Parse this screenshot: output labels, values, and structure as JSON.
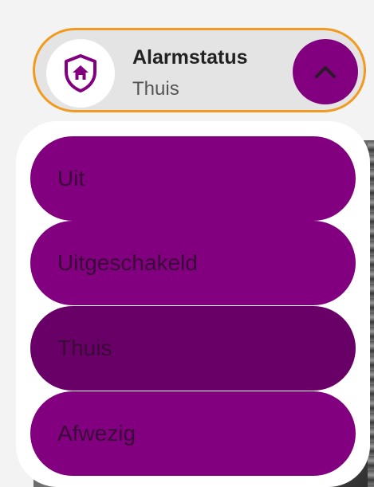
{
  "status": {
    "title": "Alarmstatus",
    "value": "Thuis",
    "icon": "shield-home-icon",
    "toggle_icon": "chevron-up-icon"
  },
  "menu": {
    "items": [
      {
        "label": "Uit",
        "selected": false
      },
      {
        "label": "Uitgeschakeld",
        "selected": false
      },
      {
        "label": "Thuis",
        "selected": true
      },
      {
        "label": "Afwezig",
        "selected": false
      }
    ]
  },
  "colors": {
    "accent": "#82007f",
    "accent_selected": "#690067",
    "focus_border": "#f29a1f"
  }
}
